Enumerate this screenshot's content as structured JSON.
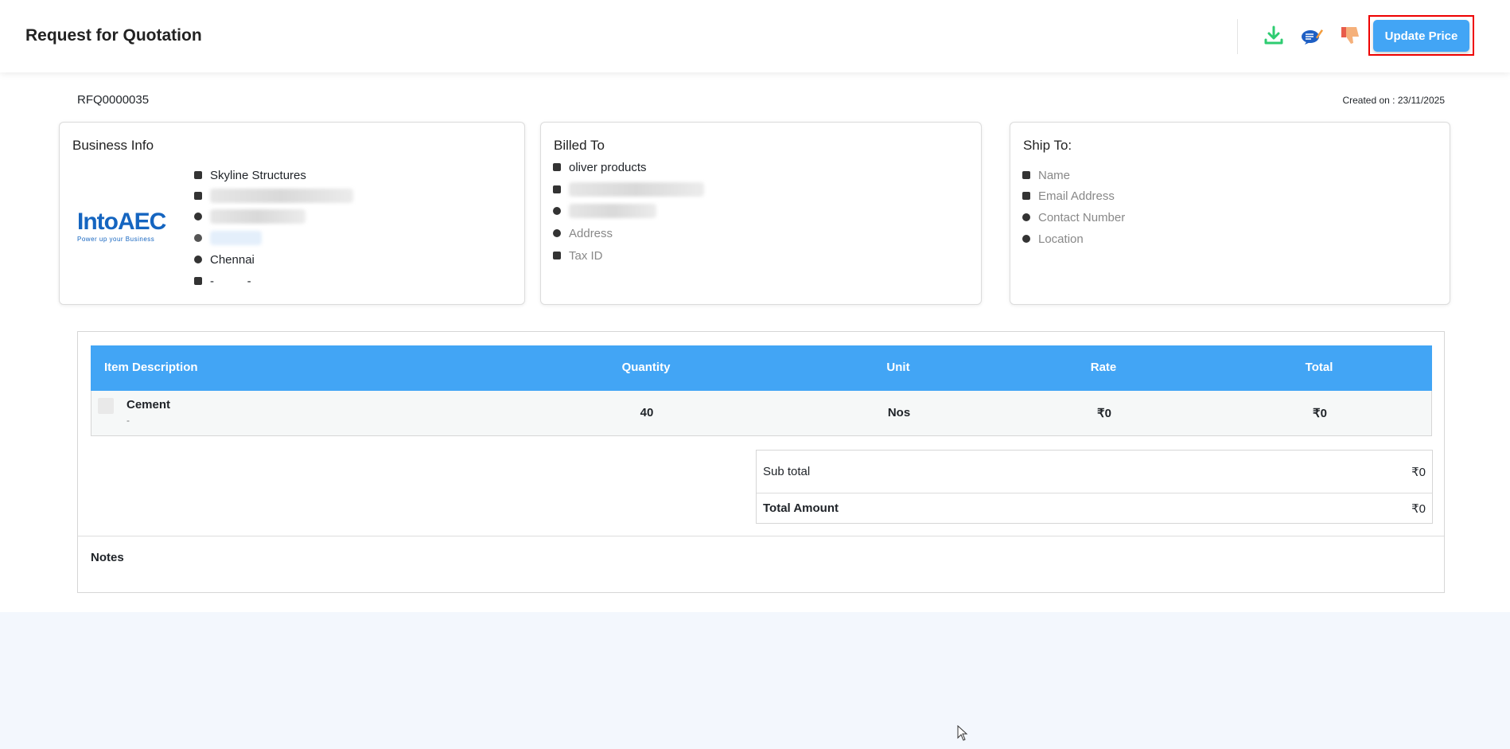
{
  "header": {
    "title": "Request for Quotation",
    "update_price_label": "Update Price",
    "icons": [
      "download-icon",
      "chat-edit-icon",
      "thumbs-down-icon"
    ]
  },
  "meta": {
    "rfq_number": "RFQ0000035",
    "created_on": "Created on : 23/11/2025"
  },
  "business_info": {
    "title": "Business Info",
    "logo_text": "IntoAEC",
    "logo_tagline": "Power up your Business",
    "name": "Skyline Structures",
    "city": "Chennai",
    "tax": "-          -"
  },
  "billed_to": {
    "title": "Billed To",
    "name": "oliver products",
    "address": "Address",
    "tax_id": "Tax ID"
  },
  "ship_to": {
    "title": "Ship To:",
    "name": "Name",
    "email": "Email Address",
    "contact": "Contact Number",
    "location": "Location"
  },
  "table": {
    "headers": [
      "Item Description",
      "Quantity",
      "Unit",
      "Rate",
      "Total"
    ],
    "rows": [
      {
        "item": "Cement",
        "sub": "-",
        "quantity": "40",
        "unit": "Nos",
        "rate": "₹0",
        "total": "₹0"
      }
    ]
  },
  "summary": {
    "subtotal_label": "Sub total",
    "subtotal": "₹0",
    "total_label": "Total Amount",
    "total": "₹0"
  },
  "notes": {
    "label": "Notes"
  },
  "colors": {
    "accent": "#42a5f5",
    "highlight": "#e00000"
  }
}
